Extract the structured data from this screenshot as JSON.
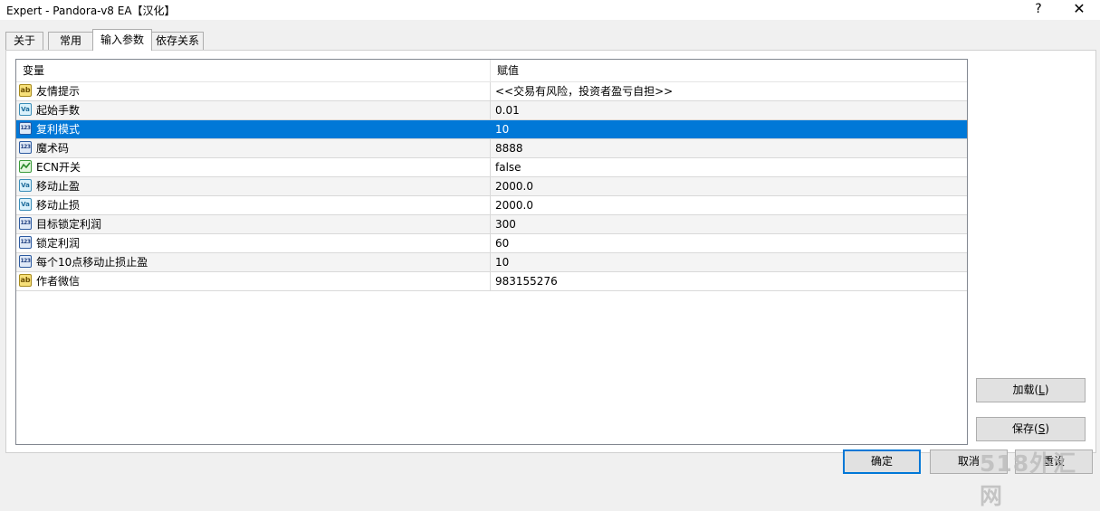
{
  "window": {
    "title": "Expert - Pandora-v8 EA【汉化】",
    "help": "?",
    "close": "✕"
  },
  "tabs": [
    {
      "label": "关于"
    },
    {
      "label": "常用"
    },
    {
      "label": "输入参数"
    },
    {
      "label": "依存关系"
    }
  ],
  "active_tab": 2,
  "grid": {
    "headers": {
      "variable": "变量",
      "value": "赋值"
    },
    "rows": [
      {
        "icon": "ab",
        "name": "友情提示",
        "value": "<<交易有风险，投资者盈亏自担>>"
      },
      {
        "icon": "va",
        "name": "起始手数",
        "value": "0.01"
      },
      {
        "icon": "n123",
        "name": "复利模式",
        "value": "10",
        "selected": true
      },
      {
        "icon": "n123",
        "name": "魔术码",
        "value": "8888"
      },
      {
        "icon": "bool",
        "name": "ECN开关",
        "value": "false"
      },
      {
        "icon": "va",
        "name": "移动止盈",
        "value": "2000.0"
      },
      {
        "icon": "va",
        "name": "移动止损",
        "value": "2000.0"
      },
      {
        "icon": "n123",
        "name": "目标锁定利润",
        "value": "300"
      },
      {
        "icon": "n123",
        "name": "锁定利润",
        "value": "60"
      },
      {
        "icon": "n123",
        "name": "每个10点移动止损止盈",
        "value": "10"
      },
      {
        "icon": "ab",
        "name": "作者微信",
        "value": "983155276"
      }
    ]
  },
  "icon_labels": {
    "ab": "ab",
    "va": "Va",
    "n123": "123"
  },
  "buttons": {
    "load": {
      "label": "加载",
      "hotkey": "L"
    },
    "save": {
      "label": "保存",
      "hotkey": "S"
    },
    "ok": {
      "label": "确定"
    },
    "cancel": {
      "label": "取消"
    },
    "reset": {
      "label": "重设"
    }
  },
  "watermark": "518外汇网",
  "colors": {
    "selection": "#0078d7",
    "accent": "#0078d7"
  }
}
